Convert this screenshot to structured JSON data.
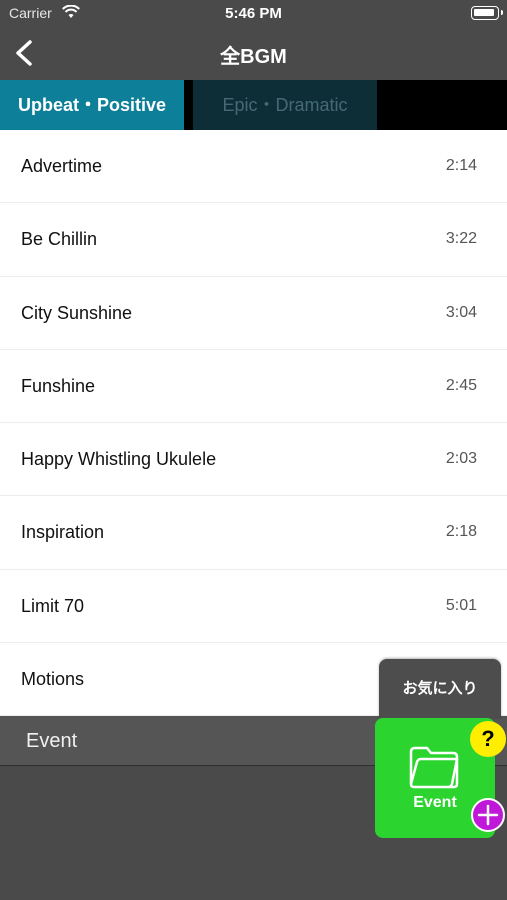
{
  "status": {
    "carrier": "Carrier",
    "time": "5:46 PM"
  },
  "nav": {
    "title": "全BGM"
  },
  "tabs": [
    {
      "label": "Upbeat・Positive",
      "active": true
    },
    {
      "label": "Epic・Dramatic",
      "active": false
    }
  ],
  "songs": [
    {
      "name": "Advertime",
      "duration": "2:14"
    },
    {
      "name": "Be Chillin",
      "duration": "3:22"
    },
    {
      "name": "City Sunshine",
      "duration": "3:04"
    },
    {
      "name": "Funshine",
      "duration": "2:45"
    },
    {
      "name": "Happy Whistling Ukulele",
      "duration": "2:03"
    },
    {
      "name": "Inspiration",
      "duration": "2:18"
    },
    {
      "name": "Limit 70",
      "duration": "5:01"
    },
    {
      "name": "Motions",
      "duration": ""
    }
  ],
  "section": {
    "label": "Event"
  },
  "favorites": {
    "label": "お気に入り"
  },
  "event_card": {
    "label": "Event",
    "icon": "folder-icon"
  },
  "help": {
    "label": "?"
  },
  "colors": {
    "accent": "#0e7f99",
    "event_green": "#2cd430",
    "help_yellow": "#ffee00",
    "add_magenta": "#c018d8"
  }
}
